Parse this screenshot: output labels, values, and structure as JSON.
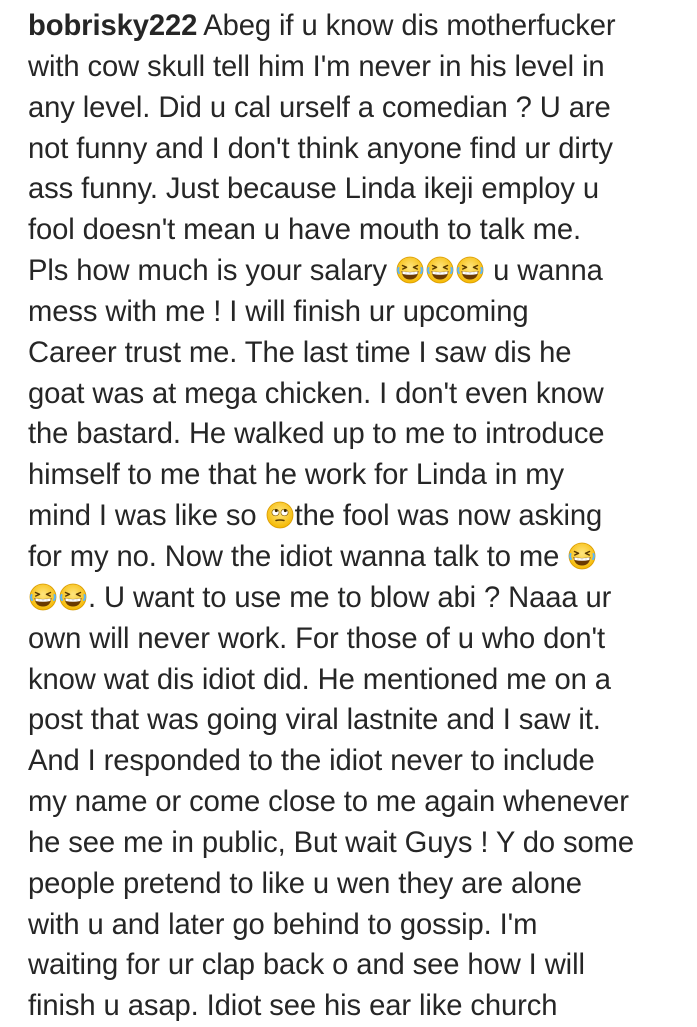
{
  "post": {
    "username": "bobrisky222",
    "lines": [
      "Abeg if u know dis motherfucker",
      "with cow skull tell him I'm never in his level in",
      "any level. Did u cal urself a comedian ? U are",
      "not funny and I don't think anyone find ur dirty",
      "ass funny. Just because Linda ikeji employ u",
      "fool doesn't mean u have mouth to talk me.",
      "Pls how much is your salary",
      "u wanna",
      "mess with me ! I will finish ur upcoming",
      "Career trust me. The last time I saw dis he",
      "goat was at mega chicken. I don't even know",
      "the bastard. He walked up to me to introduce",
      "himself to me that he work for Linda in my",
      "mind I was like so",
      "the fool was now asking",
      "for my no. Now the idiot wanna talk to me",
      ". U want to use me to blow abi ? Naaa ur",
      "own will never work. For those of u who don't",
      "know wat dis idiot did. He mentioned me on a",
      "post that was going viral lastnite and I saw it.",
      "And I responded to the idiot never to include",
      "my name or come close to me again whenever",
      "he see me in public, But wait Guys ! Y do some",
      "people pretend to like u wen they are alone",
      "with u and later go behind to gossip. I'm",
      "waiting for ur clap back o and see how I will",
      "finish u asap. Idiot see his ear like church"
    ],
    "emoji_icons": {
      "laugh": "grinning-squinting-face-icon",
      "eyeroll": "face-with-rolling-eyes-icon"
    }
  }
}
